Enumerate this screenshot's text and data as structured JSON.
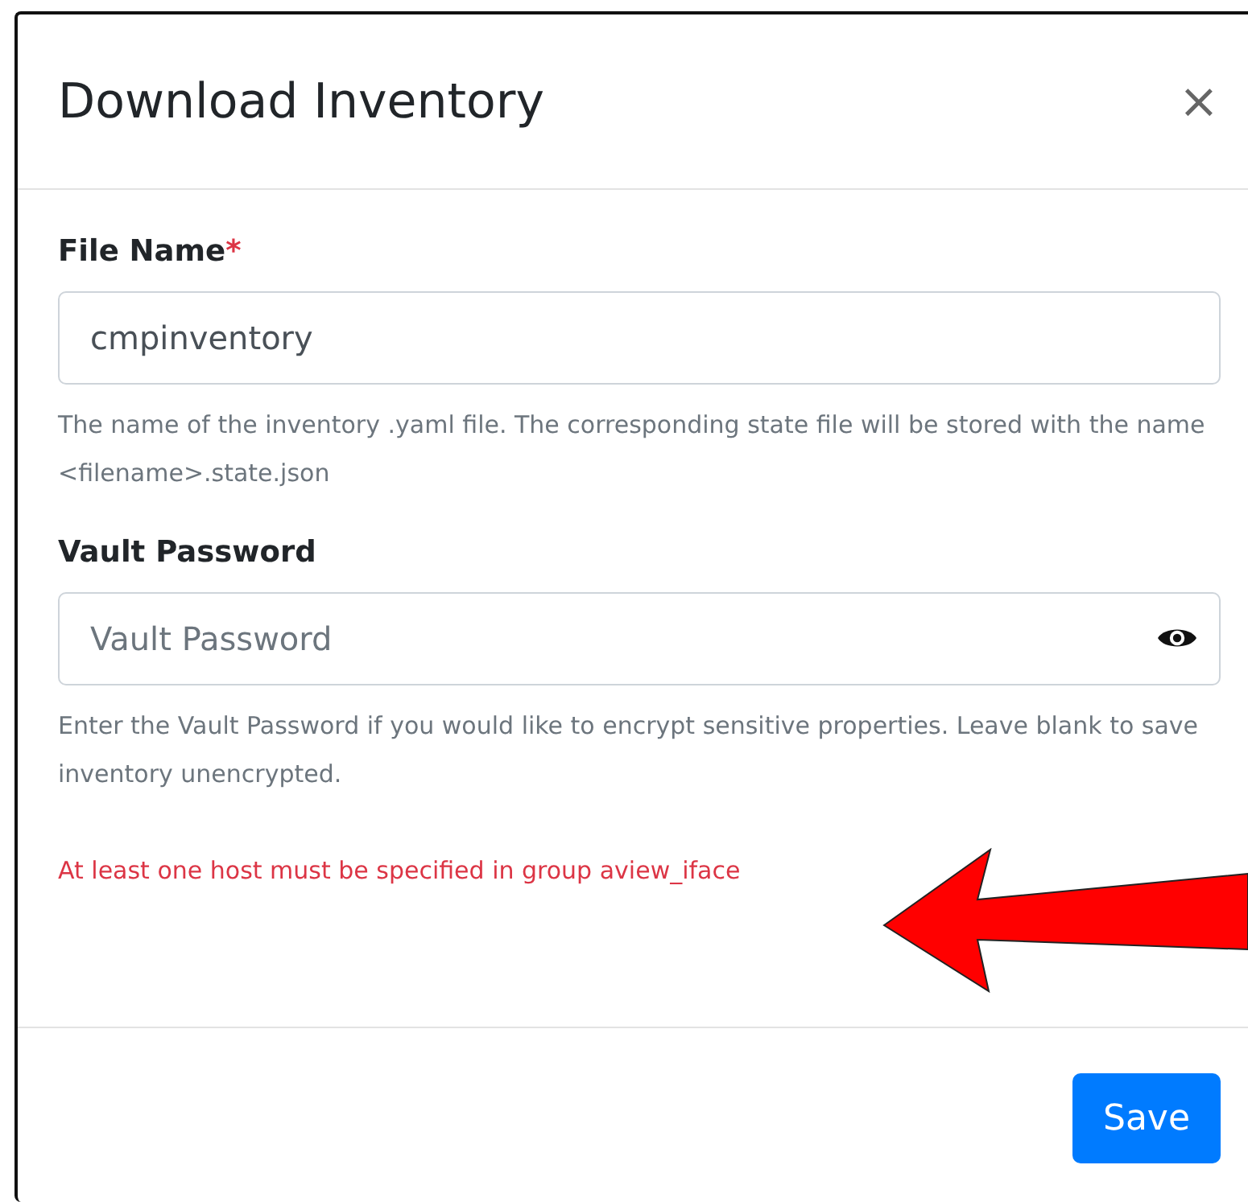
{
  "dialog": {
    "title": "Download Inventory",
    "close": "×"
  },
  "fields": [
    {
      "kind": "text",
      "label": "File Name",
      "required_mark": "*",
      "value": "cmpinventory",
      "help": "The name of the inventory .yaml file. The corresponding state file will be stored with the name <filename>.state.json"
    },
    {
      "kind": "password",
      "label": "Vault Password",
      "placeholder": "Vault Password",
      "help": "Enter the Vault Password if you would like to encrypt sensitive properties. Leave blank to save inventory unencrypted."
    }
  ],
  "error": "At least one host must be specified in group aview_iface",
  "annotation": {
    "kind": "arrow"
  },
  "buttons": [
    "Save"
  ]
}
